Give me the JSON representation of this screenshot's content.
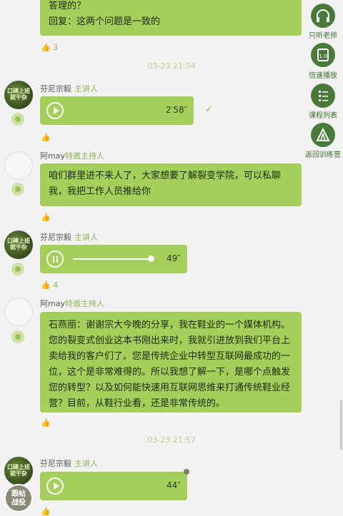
{
  "messages": {
    "m1": {
      "line1": "答理的？",
      "line2": "回复：这两个问题是一致的"
    },
    "t1": "03-23 21:54",
    "m2": {
      "name": "芬尼宗毅",
      "role": "主讲人",
      "duration": "2′58″",
      "check": "✓"
    },
    "m3": {
      "name": "阿may",
      "role": "特邀主持人",
      "text": "咱们群里进不来人了，大家想要了解裂变学院，可以私聊我，我把工作人员推给你"
    },
    "m4": {
      "name": "芬尼宗毅",
      "role": "主讲人",
      "duration": "49″",
      "like_count": "4"
    },
    "m5": {
      "name": "阿may",
      "role": "特邀主持人",
      "text": "石燕丽：谢谢宗大今晚的分享，我在鞋业的一个媒体机构。您的裂变式创业这本书刚出来时，我就引进放到我们平台上卖给我的客户们了。您是传统企业中转型互联网最成功的一位，这个是非常难得的。所以我想了解一下，是哪个点触发您的转型？以及如何能快速用互联网思维来打通传统鞋业经营？目前，从鞋行业看，还是非常传统的。"
    },
    "t2": "03-23 21:57",
    "m6": {
      "name": "芬尼宗毅",
      "role": "主讲人",
      "duration": "44″"
    }
  },
  "avatar_text": "口碑上班就干杂",
  "bottom_badge": "跟帖\n战役",
  "sidebar": [
    {
      "label": "只听老师",
      "icon": "headphones-icon"
    },
    {
      "label": "倍速播放",
      "icon": "speed-icon"
    },
    {
      "label": "课程列表",
      "icon": "list-icon"
    },
    {
      "label": "返回训练营",
      "icon": "tent-icon"
    }
  ],
  "like_icon": "👍",
  "colors": {
    "bubble": "#a4cf5b",
    "accent": "#8fb556",
    "sidebar": "#4a7a3a"
  }
}
